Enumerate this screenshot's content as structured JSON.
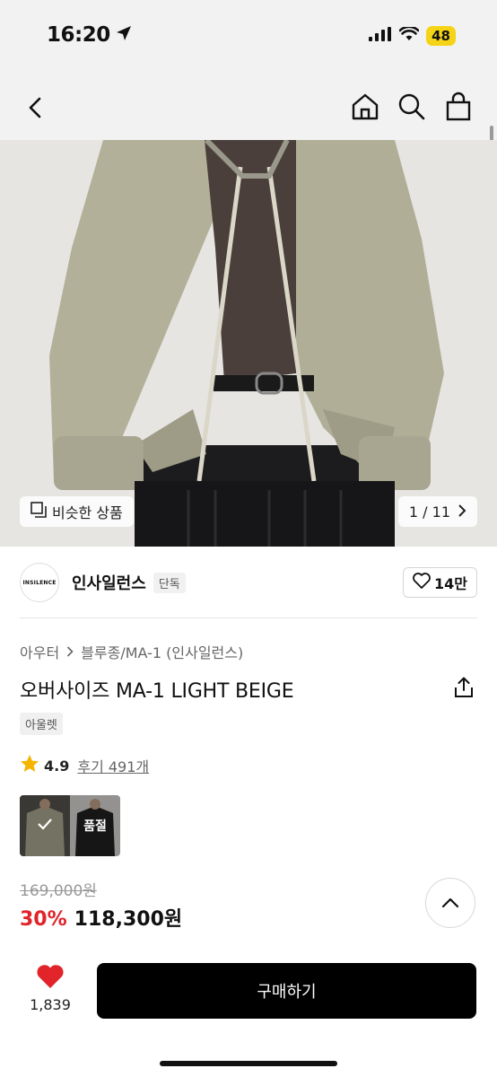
{
  "status": {
    "time": "16:20",
    "battery": "48"
  },
  "nav": {
    "back": "back-icon",
    "home": "home-icon",
    "search": "search-icon",
    "cart": "shopping-bag-icon"
  },
  "hero": {
    "similar_label": "비슷한 상품",
    "counter": "1 / 11"
  },
  "brand": {
    "logo_text": "INSILENCE",
    "name": "인사일런스",
    "tag": "단독",
    "likes": "14만"
  },
  "breadcrumb": {
    "category": "아우터",
    "subcategory": "블루종/MA-1 (인사일런스)"
  },
  "product": {
    "title": "오버사이즈 MA-1 LIGHT BEIGE",
    "badge": "아울렛",
    "rating": "4.9",
    "reviews": "후기 491개"
  },
  "options": [
    {
      "state": "selected",
      "label": ""
    },
    {
      "state": "soldout",
      "label": "품절"
    }
  ],
  "price": {
    "original": "169,000원",
    "discount": "30%",
    "sale": "118,300원"
  },
  "bottom": {
    "like_count": "1,839",
    "buy_label": "구매하기"
  },
  "colors": {
    "accent_red": "#e0242a",
    "buy_bg": "#000000",
    "star": "#f5b400",
    "battery": "#f5d417"
  }
}
